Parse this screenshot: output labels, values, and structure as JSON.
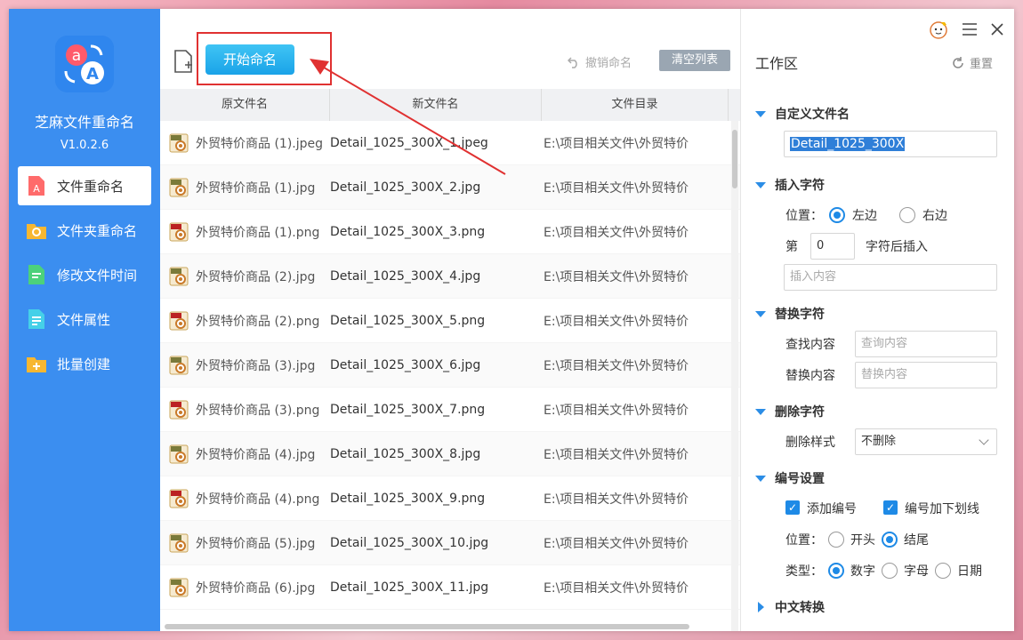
{
  "app": {
    "name": "芝麻文件重命名",
    "version": "V1.0.2.6"
  },
  "nav": [
    {
      "label": "文件重命名",
      "icon": "file-rename-icon",
      "active": true
    },
    {
      "label": "文件夹重命名",
      "icon": "folder-rename-icon"
    },
    {
      "label": "修改文件时间",
      "icon": "file-time-icon"
    },
    {
      "label": "文件属性",
      "icon": "file-attribute-icon"
    },
    {
      "label": "批量创建",
      "icon": "batch-create-icon"
    }
  ],
  "toolbar": {
    "start_label": "开始命名",
    "undo_label": "撤销命名",
    "clear_label": "清空列表"
  },
  "table": {
    "columns": [
      "原文件名",
      "新文件名",
      "文件目录"
    ],
    "rows": [
      {
        "orig": "外贸特价商品 (1).jpeg",
        "new": "Detail_1025_300X_1.jpeg",
        "dir": "E:\\项目相关文件\\外贸特价",
        "type": "jpg"
      },
      {
        "orig": "外贸特价商品 (1).jpg",
        "new": "Detail_1025_300X_2.jpg",
        "dir": "E:\\项目相关文件\\外贸特价",
        "type": "jpg"
      },
      {
        "orig": "外贸特价商品 (1).png",
        "new": "Detail_1025_300X_3.png",
        "dir": "E:\\项目相关文件\\外贸特价",
        "type": "png"
      },
      {
        "orig": "外贸特价商品 (2).jpg",
        "new": "Detail_1025_300X_4.jpg",
        "dir": "E:\\项目相关文件\\外贸特价",
        "type": "jpg"
      },
      {
        "orig": "外贸特价商品 (2).png",
        "new": "Detail_1025_300X_5.png",
        "dir": "E:\\项目相关文件\\外贸特价",
        "type": "png"
      },
      {
        "orig": "外贸特价商品 (3).jpg",
        "new": "Detail_1025_300X_6.jpg",
        "dir": "E:\\项目相关文件\\外贸特价",
        "type": "jpg"
      },
      {
        "orig": "外贸特价商品 (3).png",
        "new": "Detail_1025_300X_7.png",
        "dir": "E:\\项目相关文件\\外贸特价",
        "type": "png"
      },
      {
        "orig": "外贸特价商品 (4).jpg",
        "new": "Detail_1025_300X_8.jpg",
        "dir": "E:\\项目相关文件\\外贸特价",
        "type": "jpg"
      },
      {
        "orig": "外贸特价商品 (4).png",
        "new": "Detail_1025_300X_9.png",
        "dir": "E:\\项目相关文件\\外贸特价",
        "type": "png"
      },
      {
        "orig": "外贸特价商品 (5).jpg",
        "new": "Detail_1025_300X_10.jpg",
        "dir": "E:\\项目相关文件\\外贸特价",
        "type": "jpg"
      },
      {
        "orig": "外贸特价商品 (6).jpg",
        "new": "Detail_1025_300X_11.jpg",
        "dir": "E:\\项目相关文件\\外贸特价",
        "type": "jpg"
      }
    ]
  },
  "panel": {
    "title": "工作区",
    "reset_label": "重置",
    "custom_name": {
      "heading": "自定义文件名",
      "value": "Detail_1025_300X"
    },
    "insert": {
      "heading": "插入字符",
      "position_label": "位置：",
      "left_label": "左边",
      "right_label": "右边",
      "nth_label": "第",
      "nth_value": "0",
      "after_label": "字符后插入",
      "content_placeholder": "插入内容"
    },
    "replace": {
      "heading": "替换字符",
      "find_label": "查找内容",
      "find_placeholder": "查询内容",
      "replace_label": "替换内容",
      "replace_placeholder": "替换内容"
    },
    "delete": {
      "heading": "删除字符",
      "style_label": "删除样式",
      "style_value": "不删除"
    },
    "numbering": {
      "heading": "编号设置",
      "add_label": "添加编号",
      "underscore_label": "编号加下划线",
      "position_label": "位置：",
      "start_label": "开头",
      "end_label": "结尾",
      "type_label": "类型：",
      "digit_label": "数字",
      "letter_label": "字母",
      "date_label": "日期"
    },
    "chinese": {
      "heading": "中文转换"
    }
  },
  "colors": {
    "sidebar": "#3b8ef0",
    "accent": "#1e8ae6",
    "highlight": "#e03131"
  }
}
